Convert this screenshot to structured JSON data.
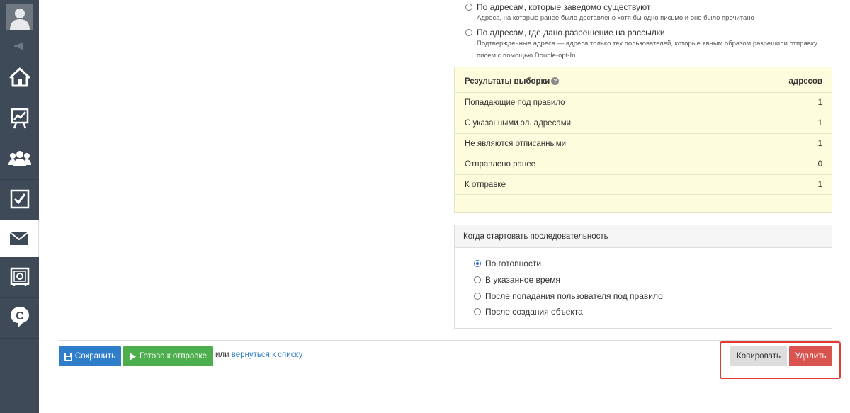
{
  "sidebar": {
    "items": [
      {
        "icon": "user-avatar-icon"
      },
      {
        "icon": "megaphone-icon"
      },
      {
        "icon": "home-icon"
      },
      {
        "icon": "chart-icon"
      },
      {
        "icon": "users-icon"
      },
      {
        "icon": "checkbox-icon"
      },
      {
        "icon": "envelope-icon",
        "active": true
      },
      {
        "icon": "safe-icon"
      },
      {
        "icon": "chat-c-icon"
      }
    ]
  },
  "address_options": {
    "existing": {
      "label": "По адресам, которые заведомо существуют",
      "hint": "Адреса, на которые ранее было доставлено хотя бы одно письмо и оно было прочитано"
    },
    "permitted": {
      "label": "По адресам, где дано разрешение на рассылки",
      "hint_line1": "Подтвержденные адреса — адреса только тех пользователей, которые явным образом разрешили отправку",
      "hint_line2": "писем с помощью Double-opt-In"
    }
  },
  "results": {
    "title": "Результаты выборки",
    "column": "адресов",
    "rows": [
      {
        "label": "Попадающие под правило",
        "value": "1"
      },
      {
        "label": "С указанными эл. адресами",
        "value": "1"
      },
      {
        "label": "Не являются отписанными",
        "value": "1"
      },
      {
        "label": "Отправлено ранее",
        "value": "0"
      },
      {
        "label": "К отправке",
        "value": "1"
      }
    ]
  },
  "start": {
    "title": "Когда стартовать последовательность",
    "options": [
      {
        "label": "По готовности",
        "checked": true
      },
      {
        "label": "В указанное время",
        "checked": false
      },
      {
        "label": "После попадания пользователя под правило",
        "checked": false
      },
      {
        "label": "После создания объекта",
        "checked": false
      }
    ]
  },
  "footer": {
    "save_label": "Сохранить",
    "ready_label": "Готово к отправке",
    "or_text": "или",
    "back_link": "вернуться к списку",
    "copy_label": "Копировать",
    "delete_label": "Удалить"
  },
  "colors": {
    "sidebar_bg": "#3e4a58",
    "primary": "#2f7ec9",
    "success": "#4cae4c",
    "danger": "#d9534f",
    "results_bg": "#fdfcdc",
    "highlight": "#e53935"
  }
}
